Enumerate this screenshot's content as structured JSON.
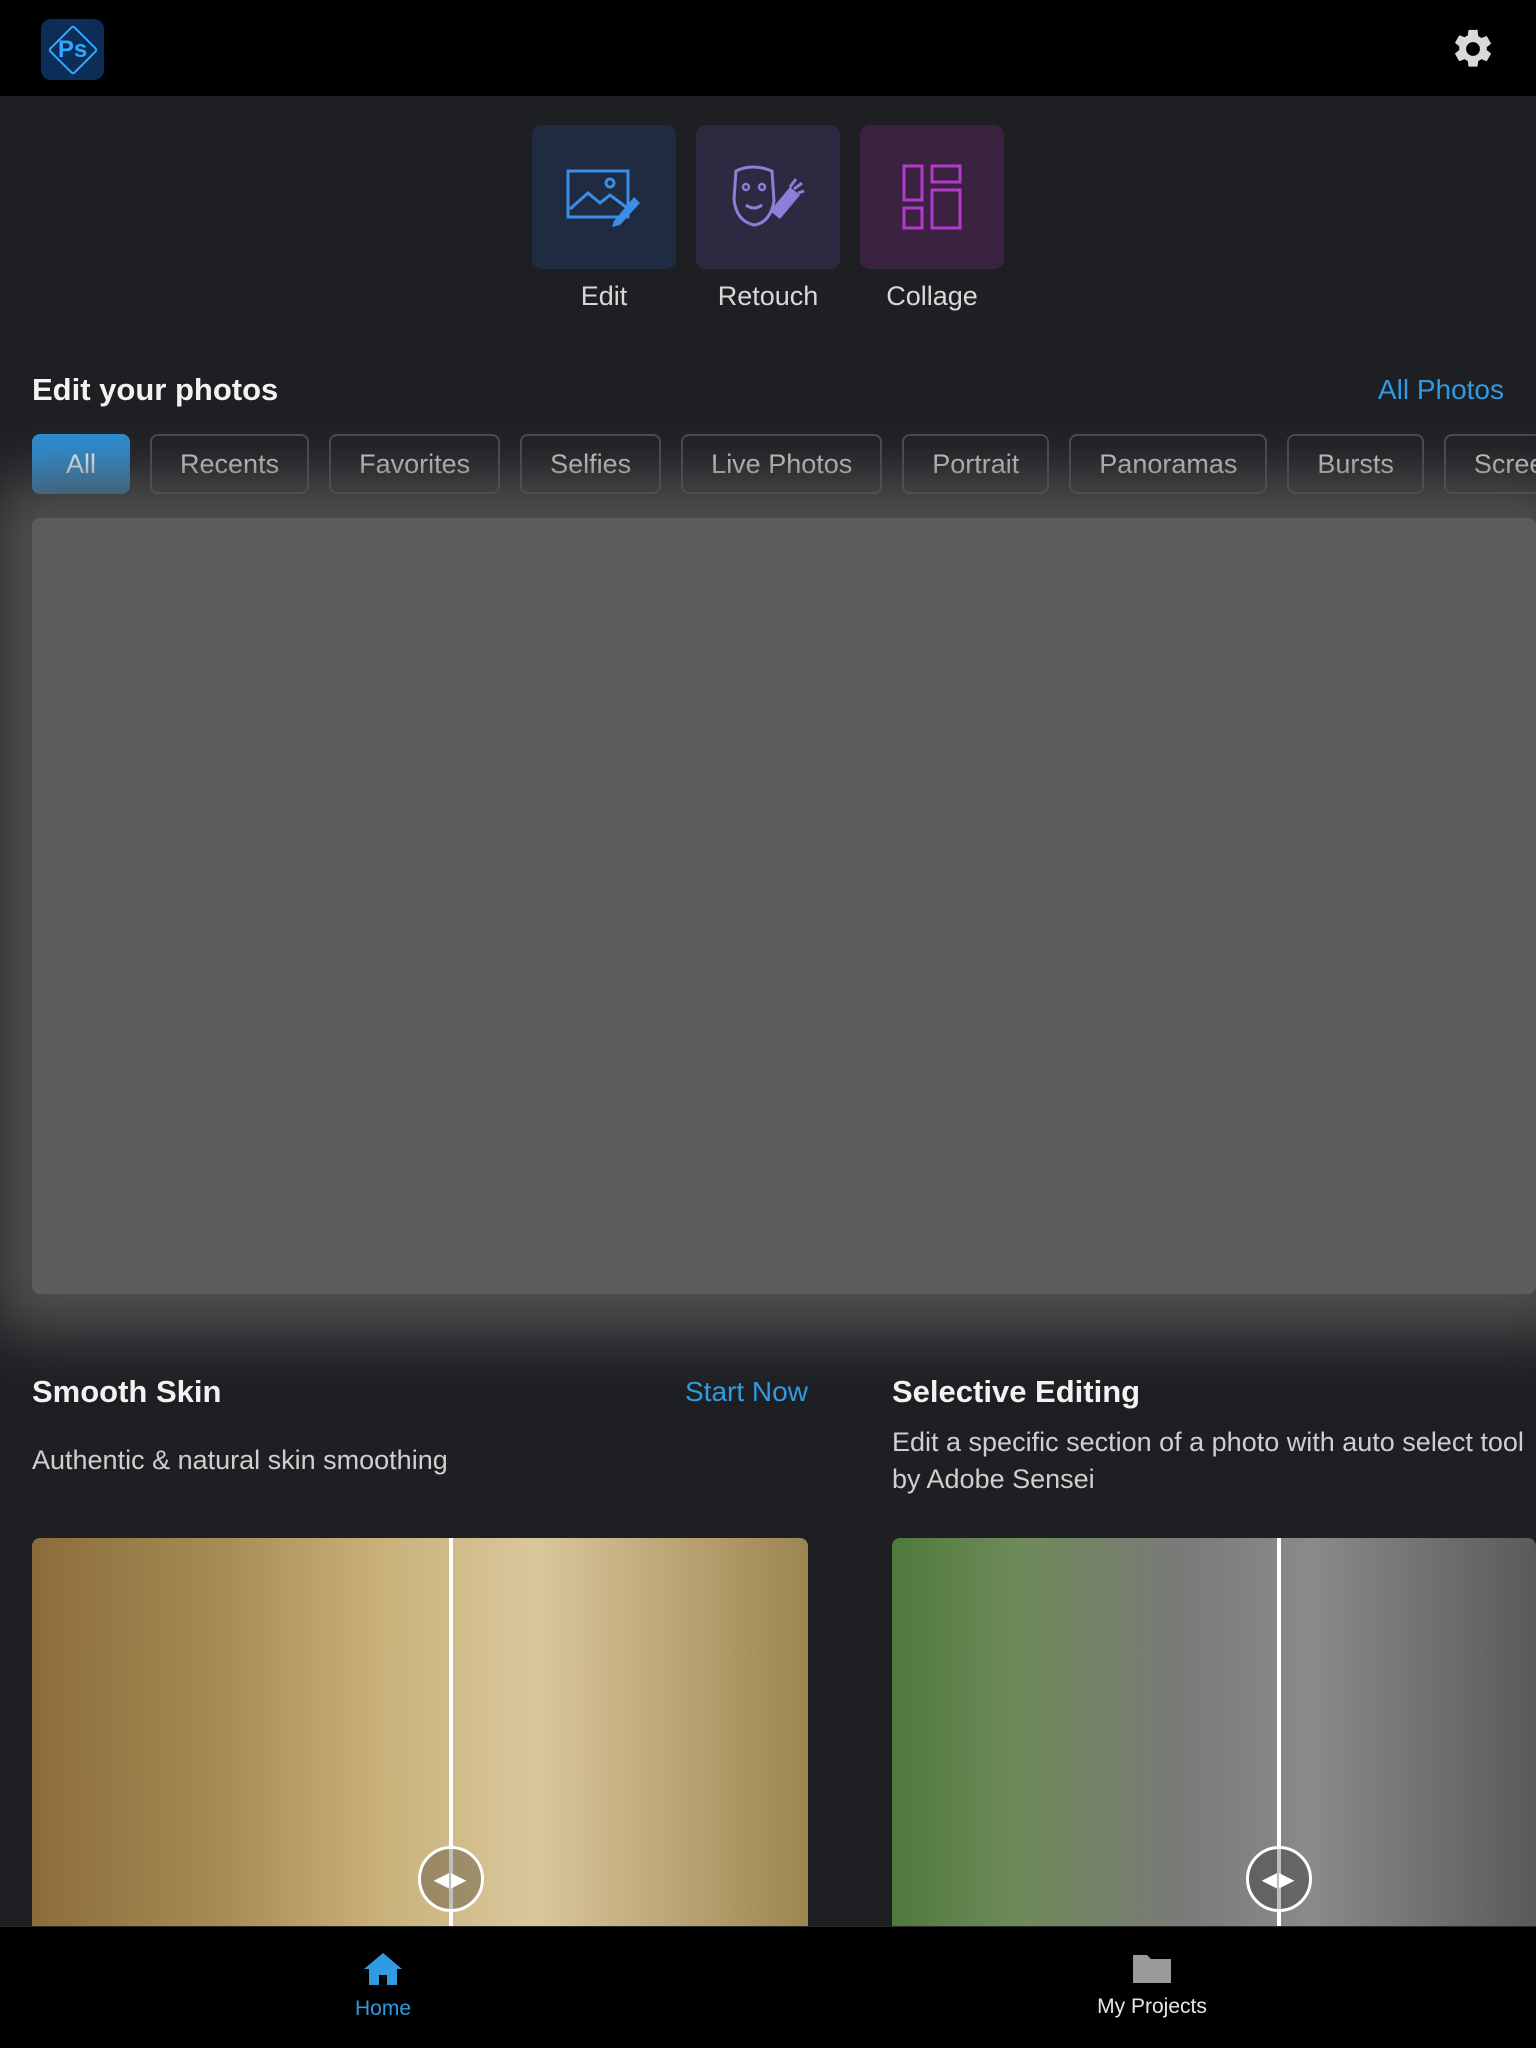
{
  "header": {
    "logo_text": "Ps",
    "logo_icon": "photoshop-express-logo",
    "settings_icon": "gear-icon"
  },
  "tools": [
    {
      "label": "Edit",
      "icon": "image-edit-icon"
    },
    {
      "label": "Retouch",
      "icon": "face-retouch-icon"
    },
    {
      "label": "Collage",
      "icon": "collage-icon"
    }
  ],
  "photos_section": {
    "title": "Edit your photos",
    "link": "All Photos",
    "filters": [
      "All",
      "Recents",
      "Favorites",
      "Selfies",
      "Live Photos",
      "Portrait",
      "Panoramas",
      "Bursts",
      "Screenshots"
    ],
    "active_filter": "All"
  },
  "features": [
    {
      "title": "Smooth Skin",
      "action": "Start Now",
      "description": "Authentic & natural skin smoothing"
    },
    {
      "title": "Selective Editing",
      "description": "Edit a specific section of a photo with auto select tool by Adobe Sensei"
    }
  ],
  "bottom_nav": {
    "items": [
      {
        "label": "Home",
        "icon": "home-icon",
        "active": true
      },
      {
        "label": "My Projects",
        "icon": "folder-icon",
        "active": false
      }
    ]
  },
  "colors": {
    "accent": "#2f9be0",
    "background": "#1e1f22",
    "topbar": "#000000"
  }
}
